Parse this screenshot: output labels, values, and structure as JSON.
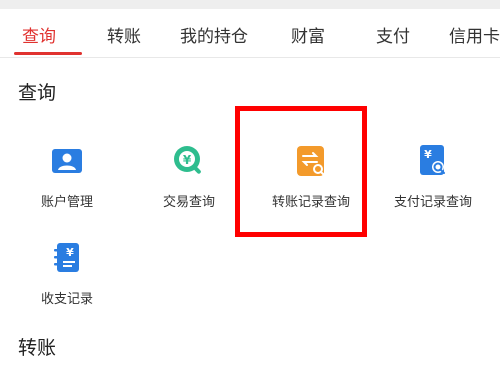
{
  "tabs": [
    {
      "label": "查询",
      "active": true
    },
    {
      "label": "转账",
      "active": false
    },
    {
      "label": "我的持仓",
      "active": false
    },
    {
      "label": "财富",
      "active": false
    },
    {
      "label": "支付",
      "active": false
    },
    {
      "label": "信用卡",
      "active": false
    }
  ],
  "query_section": {
    "title": "查询",
    "items": [
      {
        "label": "账户管理",
        "icon": "account-card-icon"
      },
      {
        "label": "交易查询",
        "icon": "yuan-search-icon"
      },
      {
        "label": "转账记录查询",
        "icon": "transfer-record-icon"
      },
      {
        "label": "支付记录查询",
        "icon": "payment-record-icon"
      },
      {
        "label": "收支记录",
        "icon": "ledger-icon"
      }
    ]
  },
  "transfer_section": {
    "title": "转账"
  },
  "colors": {
    "accent": "#e0322f",
    "highlight": "#ff0000",
    "blue": "#2a7de1",
    "green": "#2ebd8e",
    "orange": "#f39a2b"
  }
}
